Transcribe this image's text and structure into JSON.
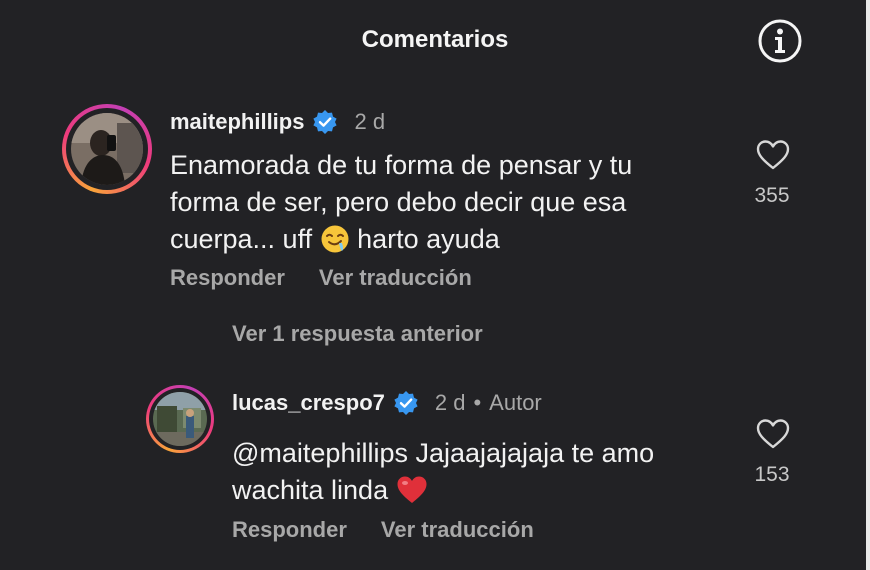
{
  "header": {
    "title": "Comentarios",
    "info_icon": "info-icon"
  },
  "comments": [
    {
      "username": "maitephillips",
      "verified": true,
      "time": "2 d",
      "text_line1": "Enamorada de tu forma de pensar y tu",
      "text_line2": "forma de ser, pero debo decir que esa",
      "text_line3_before": "cuerpa... uff",
      "emoji": "drooling-face",
      "text_line3_after": "harto ayuda",
      "reply_label": "Responder",
      "translate_label": "Ver traducción",
      "likes": "355"
    }
  ],
  "replies_toggle": "Ver 1 respuesta anterior",
  "reply": {
    "username": "lucas_crespo7",
    "verified": true,
    "time": "2 d",
    "separator": "•",
    "author_label": "Autor",
    "text_line1": "@maitephillips Jajaajajajaja te amo",
    "text_line2": "wachita linda",
    "emoji": "red-heart",
    "reply_label": "Responder",
    "translate_label": "Ver traducción",
    "likes": "153"
  },
  "colors": {
    "background": "#222225",
    "text_primary": "#f2f2f2",
    "text_secondary": "#a8a8a8",
    "verified_blue": "#3897f0",
    "heart_red": "#e0303a"
  }
}
